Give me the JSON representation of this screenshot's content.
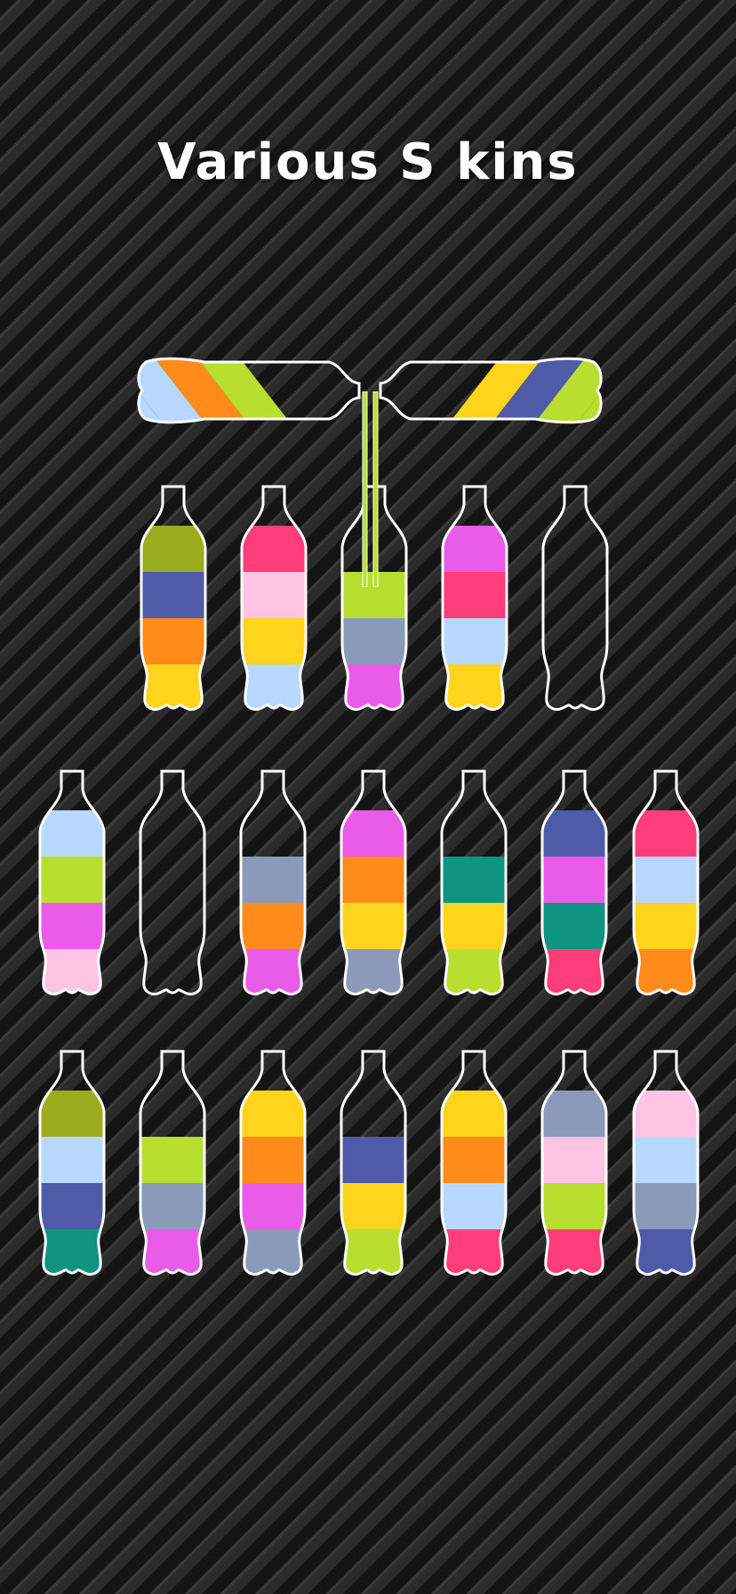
{
  "title": "Various S kins",
  "pouring": {
    "left": {
      "layers": [
        "#b8d8ff",
        "#ff8c1a",
        "#b8df2f"
      ]
    },
    "right": {
      "layers": [
        "#b8df2f",
        "#4f5aa8",
        "#ffd41c"
      ]
    },
    "stream_color": "#b8df2f"
  },
  "rows": [
    [
      {
        "layers": [
          "#9aad1e",
          "#4f5aa8",
          "#ff8c1a",
          "#ffd41c"
        ]
      },
      {
        "layers": [
          "#ff3d7a",
          "#ffc4e4",
          "#ffd41c",
          "#b8d8ff"
        ]
      },
      {
        "layers": [
          "#b8df2f",
          "#8a9ab8",
          "#e85ce8"
        ],
        "receiving": true
      },
      {
        "layers": [
          "#e85ce8",
          "#ff3d7a",
          "#b8d8ff",
          "#ffd41c"
        ]
      },
      {
        "layers": []
      }
    ],
    [
      {
        "layers": [
          "#b8d8ff",
          "#b8df2f",
          "#e85ce8",
          "#ffc4e4"
        ]
      },
      {
        "layers": []
      },
      {
        "layers": [
          "#8a9ab8",
          "#ff8c1a",
          "#e85ce8"
        ]
      },
      {
        "layers": [
          "#e85ce8",
          "#ff8c1a",
          "#ffd41c",
          "#8a9ab8"
        ]
      },
      {
        "layers": [
          "#0e9480",
          "#ffd41c",
          "#b8df2f"
        ]
      },
      {
        "layers": [
          "#4f5aa8",
          "#e85ce8",
          "#0e9480",
          "#ff3d7a"
        ]
      },
      {
        "layers": [
          "#ff3d7a",
          "#b8d8ff",
          "#ffd41c",
          "#ff8c1a"
        ]
      }
    ],
    [
      {
        "layers": [
          "#9aad1e",
          "#b8d8ff",
          "#4f5aa8",
          "#0e9480"
        ]
      },
      {
        "layers": [
          "#b8df2f",
          "#8a9ab8",
          "#e85ce8"
        ]
      },
      {
        "layers": [
          "#ffd41c",
          "#ff8c1a",
          "#e85ce8",
          "#8a9ab8"
        ]
      },
      {
        "layers": [
          "#4f5aa8",
          "#ffd41c",
          "#b8df2f"
        ]
      },
      {
        "layers": [
          "#ffd41c",
          "#ff8c1a",
          "#b8d8ff",
          "#ff3d7a"
        ]
      },
      {
        "layers": [
          "#8a9ab8",
          "#ffc4e4",
          "#b8df2f",
          "#ff3d7a"
        ]
      },
      {
        "layers": [
          "#ffc4e4",
          "#b8d8ff",
          "#8a9ab8",
          "#4f5aa8"
        ]
      }
    ]
  ]
}
